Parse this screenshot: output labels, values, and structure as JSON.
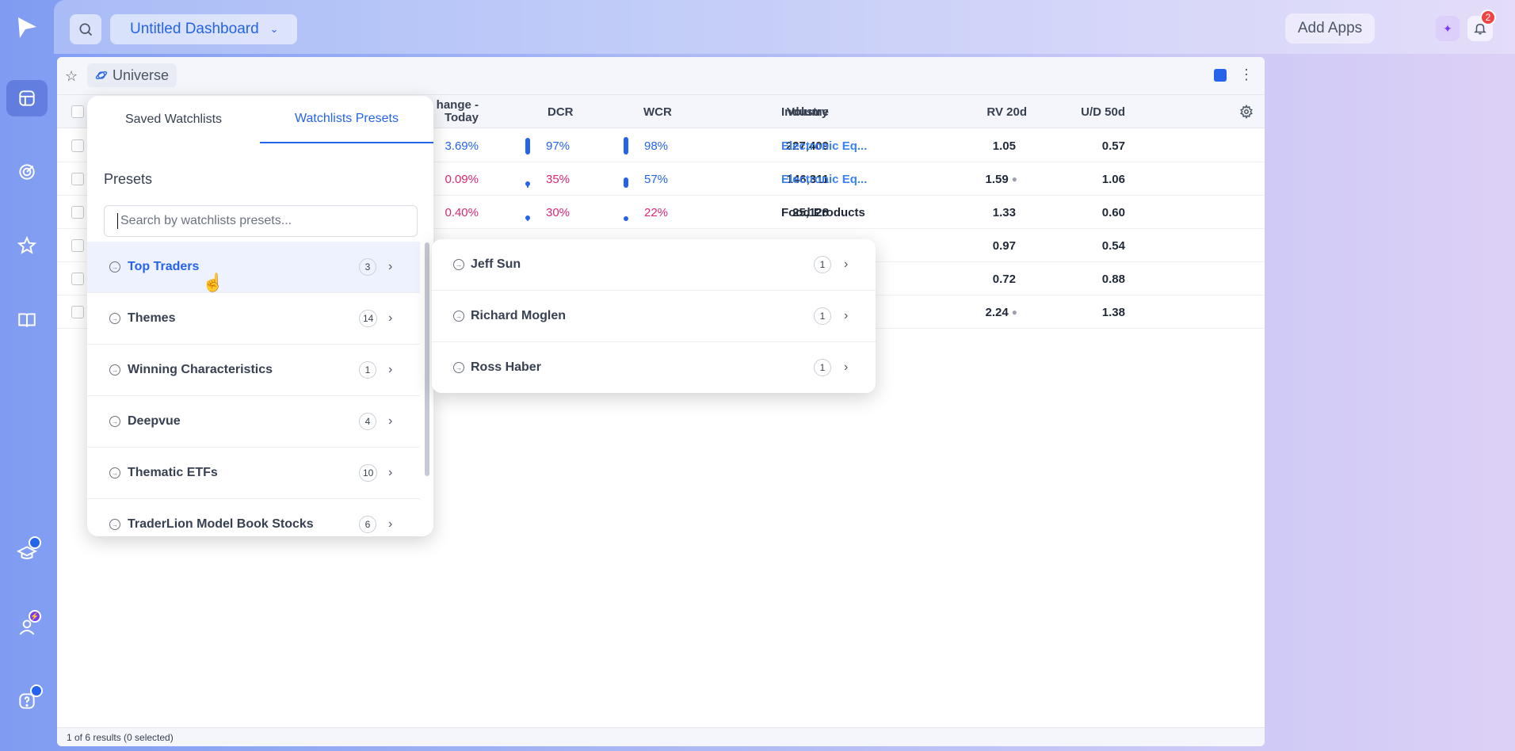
{
  "sidebar": {
    "icons": [
      {
        "name": "logo-icon"
      },
      {
        "name": "dashboard-icon",
        "active": true
      },
      {
        "name": "scanner-icon"
      },
      {
        "name": "star-icon"
      },
      {
        "name": "book-icon"
      },
      {
        "name": "academy-icon",
        "badge": ""
      },
      {
        "name": "profile-icon",
        "badge": ""
      },
      {
        "name": "help-icon",
        "badge": ""
      }
    ]
  },
  "topbar": {
    "dashboard_title": "Untitled Dashboard",
    "add_apps_label": "Add Apps",
    "notification_count": "2"
  },
  "panel": {
    "tab_label": "Universe",
    "accent_color": "#2563eb",
    "columns": {
      "change_today_line1": "hange -",
      "change_today_line2": "Today",
      "dcr": "DCR",
      "wcr": "WCR",
      "volume": "Volume",
      "industry": "Industry",
      "rv20d": "RV 20d",
      "ud50d": "U/D 50d"
    },
    "rows": [
      {
        "change": "3.69%",
        "change_color": "blue",
        "dcr": "97%",
        "dcr_color": "blue",
        "dcr_level": 0.97,
        "wcr": "98%",
        "wcr_color": "blue",
        "wcr_level": 0.98,
        "volume": "227,409",
        "industry": "Electronic Eq...",
        "industry_link": true,
        "rv": "1.05",
        "rv_dot": false,
        "ud": "0.57"
      },
      {
        "change": "0.09%",
        "change_color": "pink",
        "dcr": "35%",
        "dcr_color": "pink",
        "dcr_level": 0.35,
        "wcr": "57%",
        "wcr_color": "blue",
        "wcr_level": 0.57,
        "volume": "146,311",
        "industry": "Electronic Eq...",
        "industry_link": true,
        "rv": "1.59",
        "rv_dot": true,
        "ud": "1.06"
      },
      {
        "change": "0.40%",
        "change_color": "pink",
        "dcr": "30%",
        "dcr_color": "pink",
        "dcr_level": 0.3,
        "wcr": "22%",
        "wcr_color": "pink",
        "wcr_level": 0.22,
        "volume": "25,128",
        "industry": "Food Products",
        "industry_link": false,
        "rv": "1.33",
        "rv_dot": false,
        "ud": "0.60"
      },
      {
        "rv": "0.97",
        "rv_dot": false,
        "ud": "0.54"
      },
      {
        "rv": "0.72",
        "rv_dot": false,
        "ud": "0.88"
      },
      {
        "rv": "2.24",
        "rv_dot": true,
        "ud": "1.38"
      }
    ],
    "footer": "1 of 6 results (0 selected)"
  },
  "dropdown": {
    "tabs": [
      {
        "label": "Saved Watchlists",
        "active": false
      },
      {
        "label": "Watchlists Presets",
        "active": true
      }
    ],
    "title": "Presets",
    "search_placeholder": "Search by watchlists presets...",
    "items": [
      {
        "label": "Top Traders",
        "count": "3",
        "highlighted": true
      },
      {
        "label": "Themes",
        "count": "14",
        "highlighted": false
      },
      {
        "label": "Winning Characteristics",
        "count": "1",
        "highlighted": false
      },
      {
        "label": "Deepvue",
        "count": "4",
        "highlighted": false
      },
      {
        "label": "Thematic ETFs",
        "count": "10",
        "highlighted": false
      },
      {
        "label": "TraderLion Model Book Stocks",
        "count": "6",
        "highlighted": false
      }
    ]
  },
  "submenu": {
    "items": [
      {
        "label": "Jeff Sun",
        "count": "1"
      },
      {
        "label": "Richard Moglen",
        "count": "1"
      },
      {
        "label": "Ross Haber",
        "count": "1"
      }
    ]
  }
}
